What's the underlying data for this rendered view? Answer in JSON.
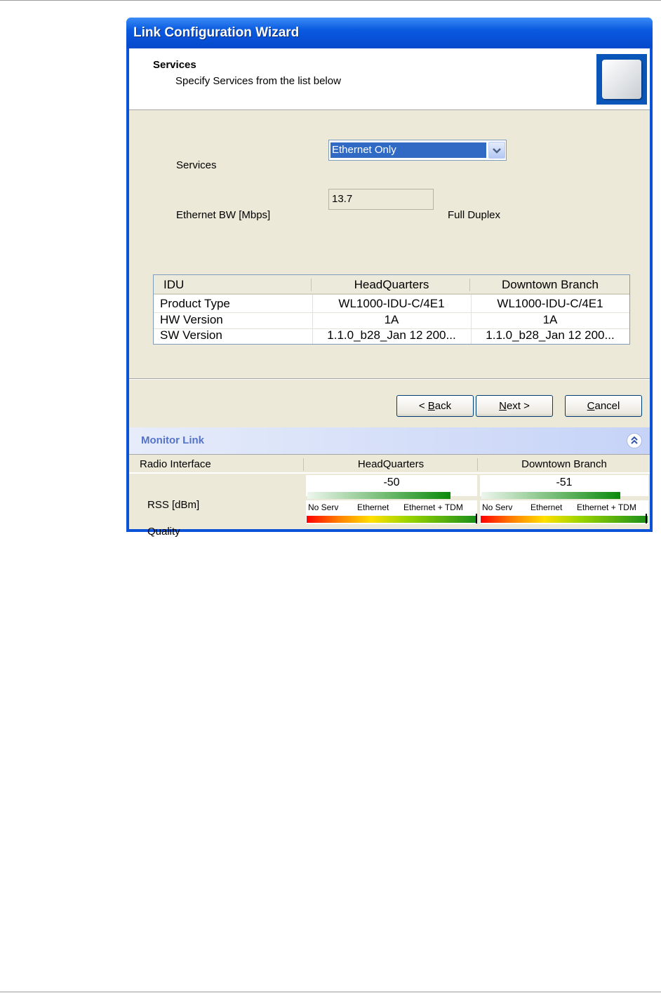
{
  "window": {
    "title": "Link Configuration Wizard"
  },
  "header": {
    "title": "Services",
    "subtitle": "Specify Services from the list below",
    "device_icon": "outdoor-unit-icon"
  },
  "form": {
    "services_label": "Services",
    "services_value": "Ethernet Only",
    "ethernet_bw_label": "Ethernet BW [Mbps]",
    "ethernet_bw_value": "13.7",
    "duplex_text": "Full Duplex"
  },
  "idu_table": {
    "columns": [
      "IDU",
      "HeadQuarters",
      "Downtown Branch"
    ],
    "rows": [
      [
        "Product Type",
        "WL1000-IDU-C/4E1",
        "WL1000-IDU-C/4E1"
      ],
      [
        "HW Version",
        "1A",
        "1A"
      ],
      [
        "SW Version",
        "1.1.0_b28_Jan 12 200...",
        "1.1.0_b28_Jan 12 200..."
      ]
    ]
  },
  "buttons": {
    "back_prefix": "< ",
    "back_key": "B",
    "back_rest": "ack",
    "next_key": "N",
    "next_rest": "ext >",
    "cancel_key": "C",
    "cancel_rest": "ancel"
  },
  "monitor": {
    "title": "Monitor Link",
    "columns": [
      "Radio Interface",
      "HeadQuarters",
      "Downtown Branch"
    ],
    "rss_label": "RSS [dBm]",
    "quality_label": "Quality",
    "rss_values": [
      "-50",
      "-51"
    ],
    "quality_scale": [
      "No Serv",
      "Ethernet",
      "Ethernet + TDM"
    ],
    "rss_bar_level": [
      0.85,
      0.84
    ],
    "quality_level": [
      1.0,
      1.0
    ],
    "colors": {
      "title": "#0a52d8",
      "selection": "#316ac5",
      "monitor_title": "#5573c7"
    }
  }
}
